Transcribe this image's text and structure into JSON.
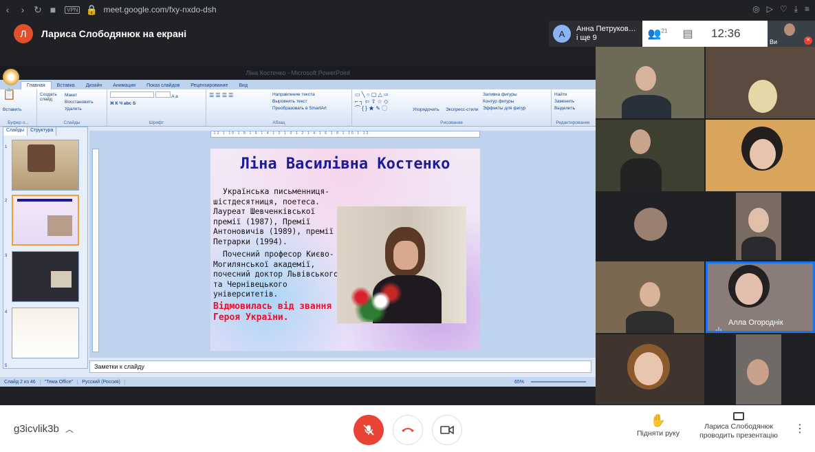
{
  "browser": {
    "url": "meet.google.com/fxy-nxdo-dsh",
    "vpn_badge": "VPN"
  },
  "header": {
    "presenter_initial": "Л",
    "presenter_title": "Лариса Слободянюк на екрані",
    "participant_initial": "А",
    "participant_name": "Анна Петруков…",
    "participant_more": "і ще 9",
    "people_count": "21",
    "time": "12:36",
    "self_label": "Ви"
  },
  "ppt": {
    "window_title": "Ліна Костенко - Microsoft PowerPoint",
    "tabs": [
      "Главная",
      "Вставка",
      "Дизайн",
      "Анимация",
      "Показ слайдов",
      "Рецензирование",
      "Вид"
    ],
    "groups": {
      "clipboard": {
        "paste": "Вставить",
        "name": "Буфер о..."
      },
      "slides": {
        "new_slide": "Создать слайд",
        "layout": "Макет",
        "reset": "Восстановить",
        "delete": "Удалить",
        "name": "Слайды"
      },
      "font": {
        "name": "Шрифт"
      },
      "paragraph": {
        "direction": "Направление текста",
        "align": "Выровнять текст",
        "smartart": "Преобразовать в SmartArt",
        "name": "Абзац"
      },
      "drawing": {
        "arrange": "Упорядочить",
        "styles": "Экспресс-стили",
        "fill": "Заливка фигуры",
        "outline": "Контур фигуры",
        "effects": "Эффекты для фигур",
        "name": "Рисование"
      },
      "editing": {
        "find": "Найти",
        "replace": "Заменить",
        "select": "Выделить",
        "name": "Редактирование"
      }
    },
    "panel_tabs": [
      "Слайды",
      "Структура"
    ],
    "thumb_numbers": [
      "1",
      "2",
      "3",
      "4",
      "5"
    ],
    "ruler_text": "·12·1·10·1·8·1·6·1·4·1·2·1·0·1·2·1·4·1·6·1·8·1·10·1·12·",
    "notes_placeholder": "Заметки к слайду",
    "status": {
      "slide": "Слайд 2 из 46",
      "theme": "\"Тема Office\"",
      "language": "Русский (Россия)",
      "zoom": "65%"
    }
  },
  "slide": {
    "title": "Ліна Василівна Костенко",
    "para1": "Українська письменниця-шістдесятниця, поетеса. Лауреат Шевченківської премії (1987), Премії Антоновичів (1989), премії Петрарки (1994).",
    "para2": "Почесний професор Києво-Могилянської академії, почесний доктор Львівського та Чернівецького університетів.",
    "red_text": "Відмовилась від звання Героя України."
  },
  "tiles": {
    "speaker_name": "Алла Огороднік"
  },
  "bottom": {
    "meeting_code": "g3icvlik3b",
    "raise_hand": "Підняти руку",
    "presenting_line1": "Лариса Слободянюк",
    "presenting_line2": "проводить презентацію"
  }
}
